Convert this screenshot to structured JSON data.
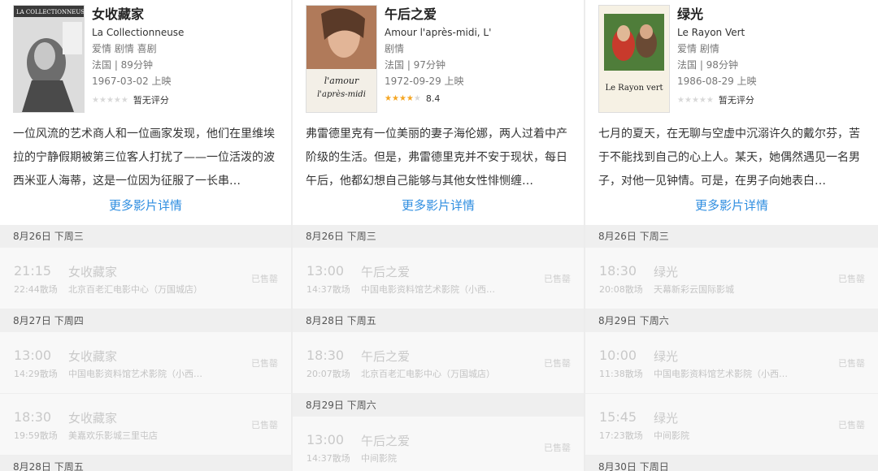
{
  "columns": [
    {
      "movie": {
        "title": "女收藏家",
        "subtitle": "La Collectionneuse",
        "genres": "爱情 剧情 喜剧",
        "country_duration": "法国 | 89分钟",
        "release": "1967-03-02 上映",
        "rating_text": "暂无评分",
        "stars": 0,
        "poster_text": "LA COLLECTIONNEUSE",
        "description": "一位风流的艺术商人和一位画家发现，他们在里维埃拉的宁静假期被第三位客人打扰了——一位活泼的波西米亚人海蒂，这是一位因为征服了一长串…",
        "more_link": "更多影片详情"
      },
      "groups": [
        {
          "date": "8月26日 下周三",
          "shows": [
            {
              "time": "21:15",
              "name": "女收藏家",
              "end": "22:44散场",
              "cinema": "北京百老汇电影中心（万国城店）",
              "status": "已售罄"
            }
          ]
        },
        {
          "date": "8月27日 下周四",
          "shows": [
            {
              "time": "13:00",
              "name": "女收藏家",
              "end": "14:29散场",
              "cinema": "中国电影资料馆艺术影院（小西天…",
              "status": "已售罄"
            },
            {
              "time": "18:30",
              "name": "女收藏家",
              "end": "19:59散场",
              "cinema": "美嘉欢乐影城三里屯店",
              "status": "已售罄"
            }
          ]
        },
        {
          "date": "8月28日 下周五",
          "shows": []
        }
      ]
    },
    {
      "movie": {
        "title": "午后之爱",
        "subtitle": "Amour l'après-midi, L'",
        "genres": "剧情",
        "country_duration": "法国 | 97分钟",
        "release": "1972-09-29 上映",
        "rating_text": "8.4",
        "stars": 4,
        "poster_text": "l'amour l'après-midi",
        "description": "弗雷德里克有一位美丽的妻子海伦娜，两人过着中产阶级的生活。但是，弗雷德里克并不安于现状，每日午后，他都幻想自己能够与其他女性悱恻缠…",
        "more_link": "更多影片详情"
      },
      "groups": [
        {
          "date": "8月26日 下周三",
          "shows": [
            {
              "time": "13:00",
              "name": "午后之爱",
              "end": "14:37散场",
              "cinema": "中国电影资料馆艺术影院（小西…",
              "status": "已售罄"
            }
          ]
        },
        {
          "date": "8月28日 下周五",
          "shows": [
            {
              "time": "18:30",
              "name": "午后之爱",
              "end": "20:07散场",
              "cinema": "北京百老汇电影中心（万国城店）",
              "status": "已售罄"
            }
          ]
        },
        {
          "date": "8月29日 下周六",
          "shows": [
            {
              "time": "13:00",
              "name": "午后之爱",
              "end": "14:37散场",
              "cinema": "中间影院",
              "status": "已售罄"
            }
          ]
        }
      ]
    },
    {
      "movie": {
        "title": "绿光",
        "subtitle": "Le Rayon Vert",
        "genres": "爱情 剧情",
        "country_duration": "法国 | 98分钟",
        "release": "1986-08-29 上映",
        "rating_text": "暂无评分",
        "stars": 0,
        "poster_text": "Le Rayon vert",
        "description": "七月的夏天，在无聊与空虚中沉溺许久的戴尔芬，苦于不能找到自己的心上人。某天，她偶然遇见一名男子，对他一见钟情。可是，在男子向她表白…",
        "more_link": "更多影片详情"
      },
      "groups": [
        {
          "date": "8月26日 下周三",
          "shows": [
            {
              "time": "18:30",
              "name": "绿光",
              "end": "20:08散场",
              "cinema": "天幕新彩云国际影城",
              "status": "已售罄"
            }
          ]
        },
        {
          "date": "8月29日 下周六",
          "shows": [
            {
              "time": "10:00",
              "name": "绿光",
              "end": "11:38散场",
              "cinema": "中国电影资料馆艺术影院（小西天…",
              "status": "已售罄"
            },
            {
              "time": "15:45",
              "name": "绿光",
              "end": "17:23散场",
              "cinema": "中间影院",
              "status": "已售罄"
            }
          ]
        },
        {
          "date": "8月30日 下周日",
          "shows": []
        }
      ]
    }
  ]
}
